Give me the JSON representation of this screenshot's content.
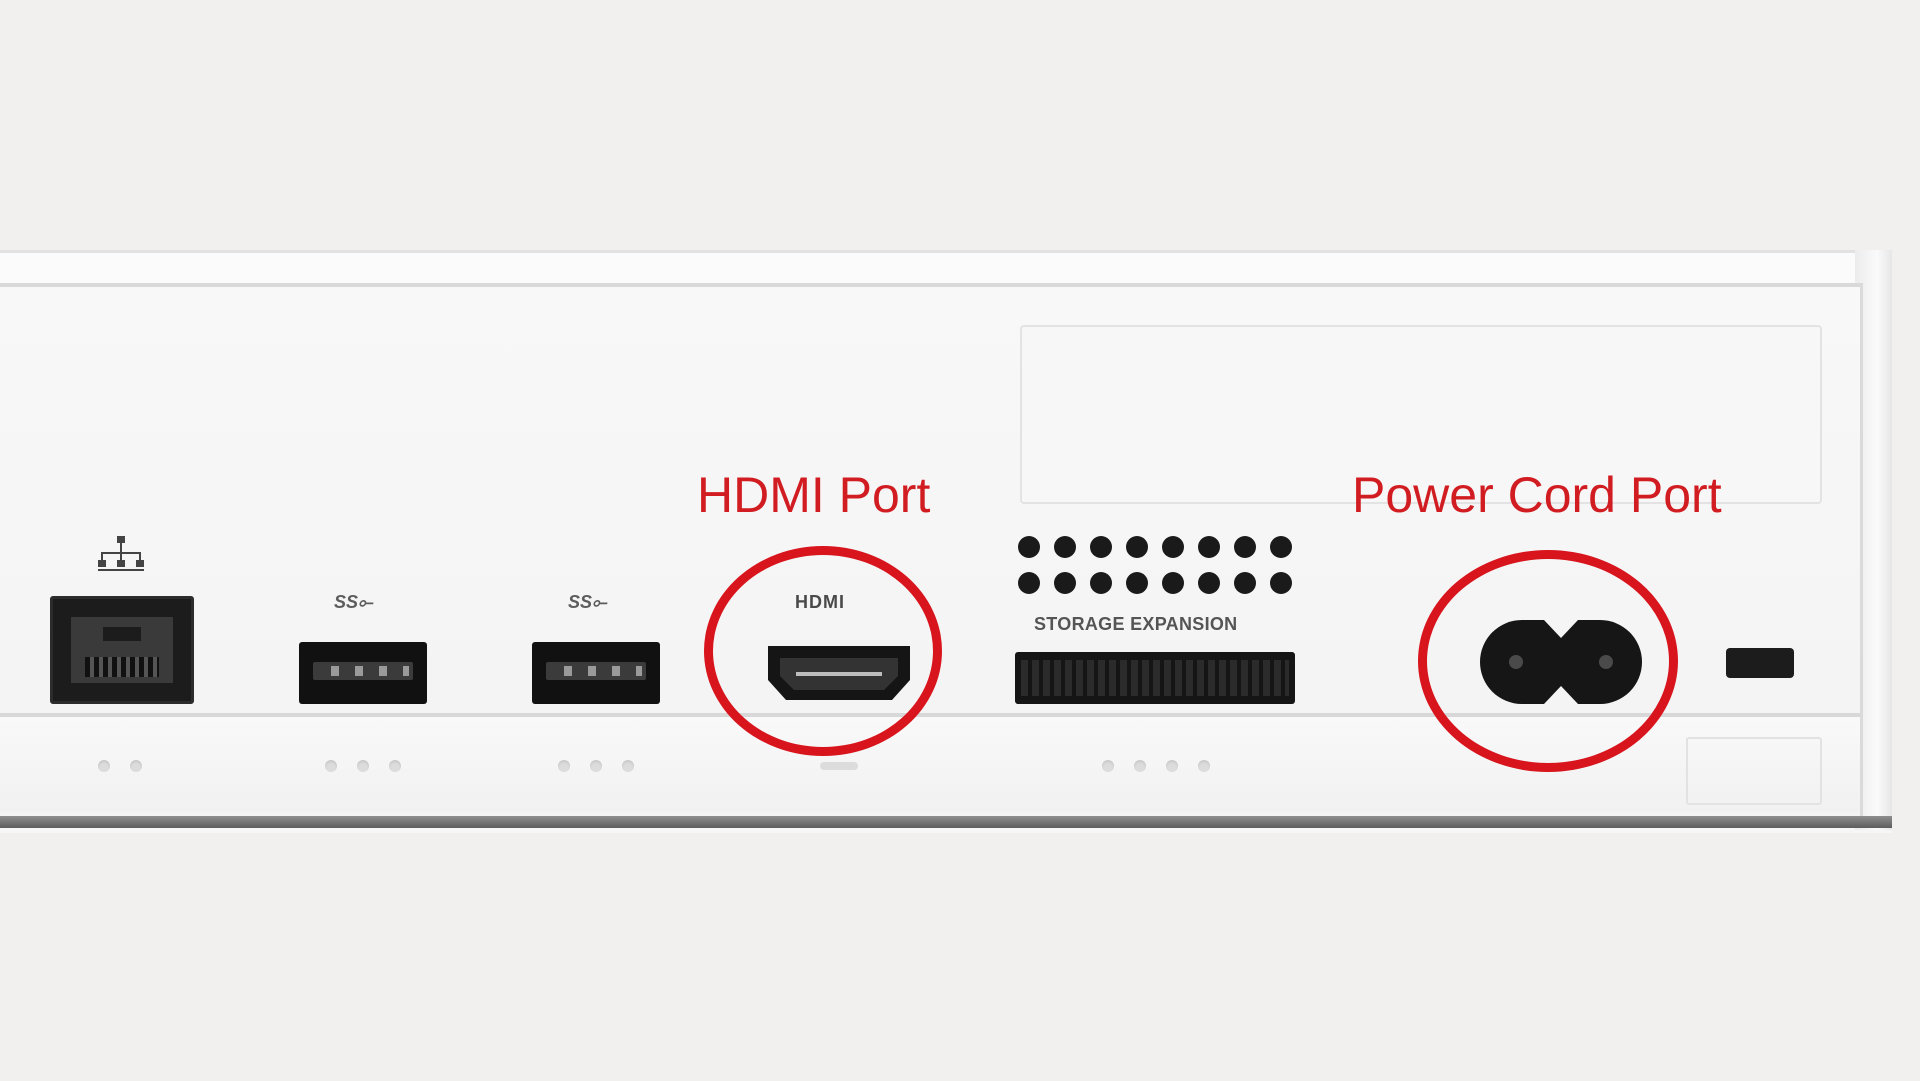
{
  "annotations": {
    "hdmi_label": "HDMI Port",
    "power_label": "Power Cord Port",
    "color": "#d11d21"
  },
  "ports": {
    "usb_logo_1": "SS⟜",
    "usb_logo_2": "SS⟜",
    "hdmi_logo": "HDMI",
    "storage_label": "STORAGE EXPANSION"
  },
  "icons": [
    "network-icon",
    "usb-ss-icon",
    "hdmi-logo",
    "power-socket-icon"
  ]
}
